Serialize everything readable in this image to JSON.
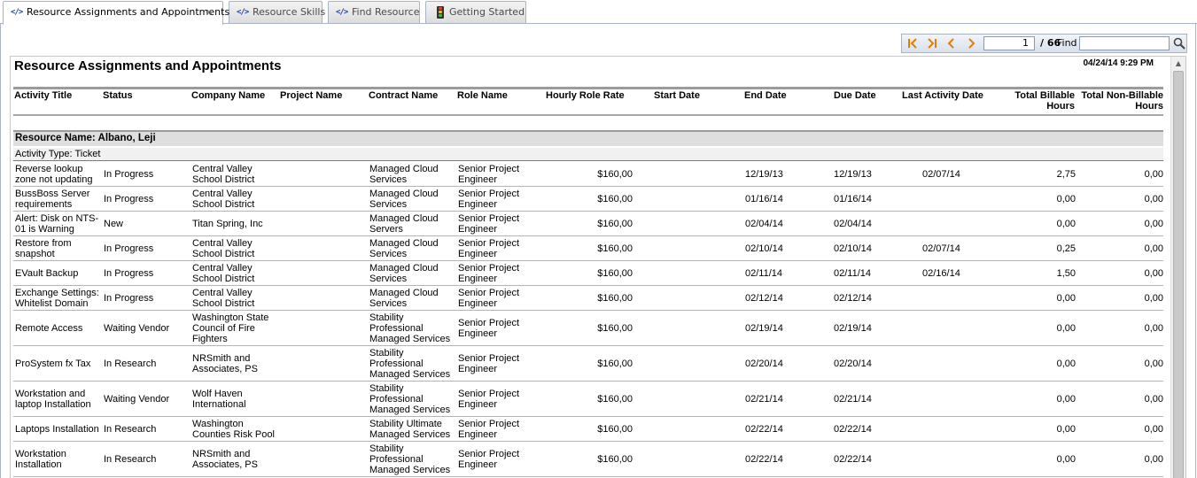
{
  "tabs": [
    {
      "label": "Resource Assignments and Appointments",
      "close": "×"
    },
    {
      "label": "Resource Skills"
    },
    {
      "label": "Find Resource"
    },
    {
      "label": "Getting Started"
    }
  ],
  "toolbar": {
    "page_current": "1",
    "page_total": "/ 66",
    "find_label": "Find",
    "find_value": ""
  },
  "report": {
    "title": "Resource Assignments and Appointments",
    "generated": "04/24/14 9:29 PM",
    "columns": {
      "activity_title": "Activity Title",
      "status": "Status",
      "company_name": "Company Name",
      "project_name": "Project Name",
      "contract_name": "Contract Name",
      "role_name": "Role Name",
      "hourly_role_rate": "Hourly Role Rate",
      "start_date": "Start Date",
      "end_date": "End Date",
      "due_date": "Due Date",
      "last_activity_date": "Last Activity Date",
      "total_billable_hours": "Total Billable\nHours",
      "total_non_billable_hours": "Total Non-Billable\nHours"
    },
    "group_label": "Resource Name: Albano, Leji",
    "activity_type": "Activity Type: Ticket",
    "rows": [
      {
        "title": "Reverse lookup\nzone not updating",
        "status": "In Progress",
        "company": "Central Valley\nSchool District",
        "project": "",
        "contract": "Managed Cloud\nServices",
        "role": "Senior Project\nEngineer",
        "rate": "$160,00",
        "start": "",
        "end": "12/19/13",
        "due": "12/19/13",
        "last": "02/07/14",
        "billable": "2,75",
        "nonbillable": "0,00"
      },
      {
        "title": "BussBoss Server\nrequirements",
        "status": "In Progress",
        "company": "Central Valley\nSchool District",
        "project": "",
        "contract": "Managed Cloud\nServices",
        "role": "Senior Project\nEngineer",
        "rate": "$160,00",
        "start": "",
        "end": "01/16/14",
        "due": "01/16/14",
        "last": "",
        "billable": "0,00",
        "nonbillable": "0,00"
      },
      {
        "title": "Alert: Disk on NTS-\n01 is Warning",
        "status": "New",
        "company": "Titan Spring, Inc",
        "project": "",
        "contract": "Managed Cloud\nServers",
        "role": "Senior Project\nEngineer",
        "rate": "$160,00",
        "start": "",
        "end": "02/04/14",
        "due": "02/04/14",
        "last": "",
        "billable": "0,00",
        "nonbillable": "0,00"
      },
      {
        "title": "Restore from\nsnapshot",
        "status": "In Progress",
        "company": "Central Valley\nSchool District",
        "project": "",
        "contract": "Managed Cloud\nServices",
        "role": "Senior Project\nEngineer",
        "rate": "$160,00",
        "start": "",
        "end": "02/10/14",
        "due": "02/10/14",
        "last": "02/07/14",
        "billable": "0,25",
        "nonbillable": "0,00"
      },
      {
        "title": "EVault Backup",
        "status": "In Progress",
        "company": "Central Valley\nSchool District",
        "project": "",
        "contract": "Managed Cloud\nServices",
        "role": "Senior Project\nEngineer",
        "rate": "$160,00",
        "start": "",
        "end": "02/11/14",
        "due": "02/11/14",
        "last": "02/16/14",
        "billable": "1,50",
        "nonbillable": "0,00"
      },
      {
        "title": "Exchange Settings:\nWhitelist Domain",
        "status": "In Progress",
        "company": "Central Valley\nSchool District",
        "project": "",
        "contract": "Managed Cloud\nServices",
        "role": "Senior Project\nEngineer",
        "rate": "$160,00",
        "start": "",
        "end": "02/12/14",
        "due": "02/12/14",
        "last": "",
        "billable": "0,00",
        "nonbillable": "0,00"
      },
      {
        "title": "Remote Access",
        "status": "Waiting Vendor",
        "company": "Washington State\nCouncil of Fire\nFighters",
        "project": "",
        "contract": "Stability\nProfessional\nManaged Services",
        "role": "Senior Project\nEngineer",
        "rate": "$160,00",
        "start": "",
        "end": "02/19/14",
        "due": "02/19/14",
        "last": "",
        "billable": "0,00",
        "nonbillable": "0,00"
      },
      {
        "title": "ProSystem fx Tax",
        "status": "In Research",
        "company": "NRSmith and\nAssociates, PS",
        "project": "",
        "contract": "Stability\nProfessional\nManaged Services",
        "role": "Senior Project\nEngineer",
        "rate": "$160,00",
        "start": "",
        "end": "02/20/14",
        "due": "02/20/14",
        "last": "",
        "billable": "0,00",
        "nonbillable": "0,00"
      },
      {
        "title": "Workstation and\nlaptop Installation",
        "status": "Waiting Vendor",
        "company": "Wolf Haven\nInternational",
        "project": "",
        "contract": "Stability\nProfessional\nManaged Services",
        "role": "Senior Project\nEngineer",
        "rate": "$160,00",
        "start": "",
        "end": "02/21/14",
        "due": "02/21/14",
        "last": "",
        "billable": "0,00",
        "nonbillable": "0,00"
      },
      {
        "title": "Laptops Installation",
        "status": "In Research",
        "company": "Washington\nCounties Risk Pool",
        "project": "",
        "contract": "Stability Ultimate\nManaged Services",
        "role": "Senior Project\nEngineer",
        "rate": "$160,00",
        "start": "",
        "end": "02/22/14",
        "due": "02/22/14",
        "last": "",
        "billable": "0,00",
        "nonbillable": "0,00"
      },
      {
        "title": "Workstation\nInstallation",
        "status": "In Research",
        "company": "NRSmith and\nAssociates, PS",
        "project": "",
        "contract": "Stability\nProfessional\nManaged Services",
        "role": "Senior Project\nEngineer",
        "rate": "$160,00",
        "start": "",
        "end": "02/22/14",
        "due": "02/22/14",
        "last": "",
        "billable": "0,00",
        "nonbillable": "0,00"
      }
    ]
  },
  "icons": {
    "first": "first-page-icon",
    "last": "last-page-icon",
    "prev": "previous-page-icon",
    "next": "next-page-icon",
    "search": "search-icon",
    "tab_code": "code-icon",
    "tab_bulb": "traffic-light-icon"
  },
  "colors": {
    "accent": "#e67e00",
    "header_rule": "#9b9b9b",
    "tab_icon": "#1f3f9f"
  }
}
